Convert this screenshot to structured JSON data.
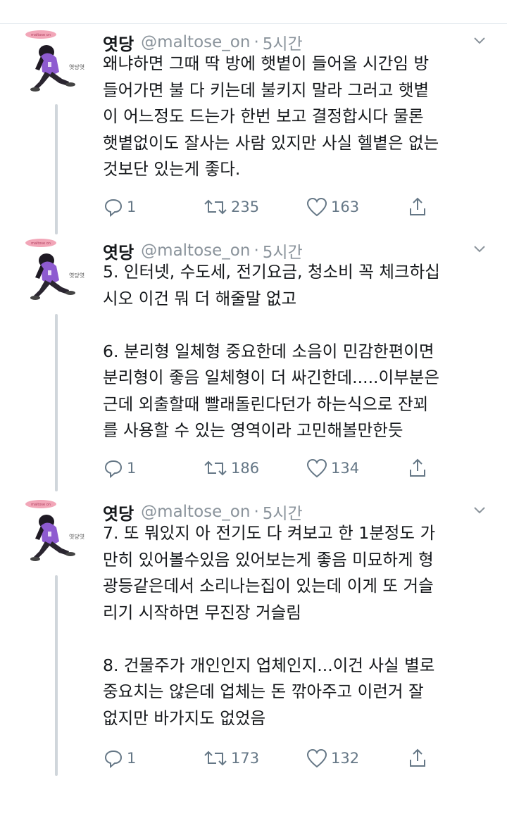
{
  "tweets": [
    {
      "name": "엿당",
      "handle": "@maltose_on",
      "separator": "·",
      "time": "5시간",
      "lines": [
        "왜냐하면 그때 딱 방에 햇볕이 들어올 시간임 방",
        "들어가면 불 다 키는데 불키지 말라 그러고 햇볕",
        "이 어느정도 드는가 한번 보고 결정합시다 물론",
        "햇볕없이도 잘사는 사람 있지만 사실 헬볕은 없는",
        "것보단 있는게 좋다."
      ],
      "replies": "1",
      "retweets": "235",
      "likes": "163",
      "avatar_badge_text": "maltose on",
      "avatar_side_text": "엿당엿"
    },
    {
      "name": "엿당",
      "handle": "@maltose_on",
      "separator": "·",
      "time": "5시간",
      "lines": [
        "5. 인터넷, 수도세, 전기요금, 청소비 꼭 체크하십",
        "시오 이건 뭐 더 해줄말 없고",
        "",
        "6. 분리형 일체형 중요한데 소음이 민감한편이면",
        "분리형이 좋음 일체형이 더 싸긴한데.....이부분은",
        "근데 외출할때 빨래돌린다던가 하는식으로 잔꾀",
        "를 사용할 수 있는 영역이라 고민해볼만한듯"
      ],
      "replies": "1",
      "retweets": "186",
      "likes": "134",
      "avatar_badge_text": "maltose on",
      "avatar_side_text": "엿당엿"
    },
    {
      "name": "엿당",
      "handle": "@maltose_on",
      "separator": "·",
      "time": "5시간",
      "lines": [
        "7. 또 뭐있지 아 전기도 다 켜보고 한 1분정도 가",
        "만히 있어볼수있음 있어보는게 좋음 미묘하게 형",
        "광등같은데서 소리나는집이 있는데 이게 또 거슬",
        "리기 시작하면 무진장 거슬림",
        "",
        "8. 건물주가 개인인지 업체인지...이건 사실 별로",
        "중요치는 않은데 업체는 돈 깎아주고 이런거 잘",
        "없지만 바가지도 없었음"
      ],
      "replies": "1",
      "retweets": "173",
      "likes": "132",
      "avatar_badge_text": "maltose on",
      "avatar_side_text": "엿당엿"
    }
  ],
  "colors": {
    "text": "#14171a",
    "secondary": "#8a939b",
    "icon": "#657786",
    "thread_line": "#d0d6db",
    "avatar_purple": "#8e5bd0",
    "badge_pink": "#f2a6b8"
  }
}
